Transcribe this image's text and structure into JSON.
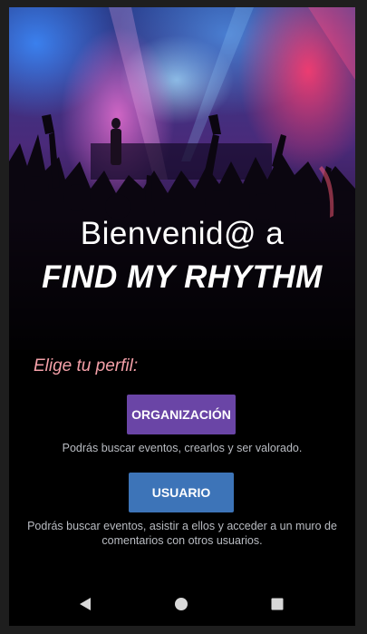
{
  "hero": {
    "greeting": "Bienvenid@ a",
    "app_name": "FIND MY RHYTHM"
  },
  "profile": {
    "prompt": "Elige tu perfil:",
    "organization": {
      "label": "ORGANIZACIÓN",
      "description": "Podrás buscar eventos, crearlos y ser valorado."
    },
    "user": {
      "label": "USUARIO",
      "description": "Podrás buscar eventos, asistir a ellos y acceder a un muro de comentarios con otros usuarios."
    }
  },
  "navbar": {
    "back_icon": "back-triangle-icon",
    "home_icon": "home-circle-icon",
    "recents_icon": "recents-square-icon"
  },
  "colors": {
    "organization_button": "#6a45a6",
    "user_button": "#3d74b8",
    "prompt_text": "#f4a0a8"
  }
}
